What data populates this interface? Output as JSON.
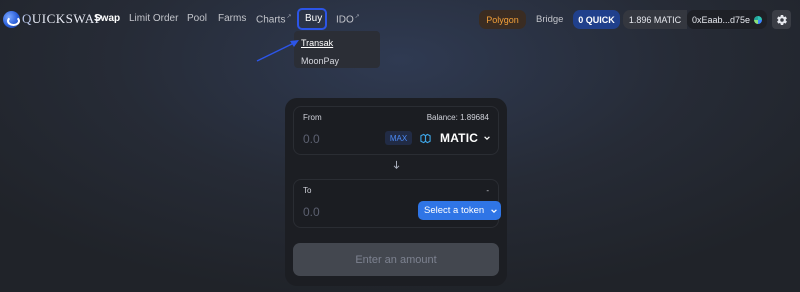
{
  "brand": {
    "logo_text_q": "Q",
    "logo_text_rest": "UICKSWAP"
  },
  "nav": {
    "items": [
      {
        "label": "Swap",
        "active": true
      },
      {
        "label": "Limit Order"
      },
      {
        "label": "Pool"
      },
      {
        "label": "Farms"
      },
      {
        "label": "Charts",
        "external": "↗"
      },
      {
        "label": "Buy",
        "highlighted": true
      },
      {
        "label": "IDO",
        "external": "↗"
      }
    ]
  },
  "buy_dropdown": {
    "items": [
      "Transak",
      "MoonPay"
    ]
  },
  "header_right": {
    "network": "Polygon",
    "bridge": "Bridge",
    "quick_balance": "0 QUICK",
    "matic_balance": "1.896 MATIC",
    "address": "0xEaab...d75e"
  },
  "swap": {
    "from": {
      "label": "From",
      "balance": "Balance: 1.89684",
      "amount_placeholder": "0.0",
      "max_label": "MAX",
      "token": "MATIC"
    },
    "to": {
      "label": "To",
      "balance": "-",
      "amount_placeholder": "0.0",
      "select_label": "Select a token"
    },
    "submit_label": "Enter an amount"
  },
  "colors": {
    "accent_blue": "#2f75e6",
    "highlight_border": "#2c55e8",
    "network_orange": "#f4a13a",
    "quick_pill": "#20408c"
  },
  "icons": [
    "quickswap-logo-icon",
    "arrow-annotation-icon",
    "matic-token-icon",
    "chevron-down-icon",
    "arrow-down-icon",
    "gear-icon",
    "wallet-avatar-icon"
  ]
}
